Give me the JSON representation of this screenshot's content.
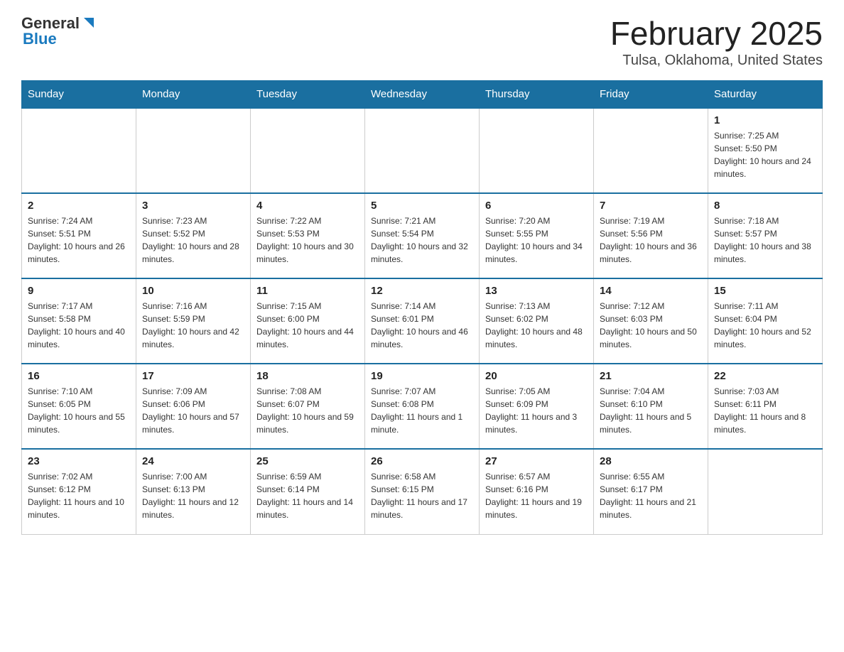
{
  "header": {
    "logo_general": "General",
    "logo_blue": "Blue",
    "month_title": "February 2025",
    "location": "Tulsa, Oklahoma, United States"
  },
  "days_of_week": [
    "Sunday",
    "Monday",
    "Tuesday",
    "Wednesday",
    "Thursday",
    "Friday",
    "Saturday"
  ],
  "weeks": [
    [
      {
        "day": "",
        "info": ""
      },
      {
        "day": "",
        "info": ""
      },
      {
        "day": "",
        "info": ""
      },
      {
        "day": "",
        "info": ""
      },
      {
        "day": "",
        "info": ""
      },
      {
        "day": "",
        "info": ""
      },
      {
        "day": "1",
        "info": "Sunrise: 7:25 AM\nSunset: 5:50 PM\nDaylight: 10 hours and 24 minutes."
      }
    ],
    [
      {
        "day": "2",
        "info": "Sunrise: 7:24 AM\nSunset: 5:51 PM\nDaylight: 10 hours and 26 minutes."
      },
      {
        "day": "3",
        "info": "Sunrise: 7:23 AM\nSunset: 5:52 PM\nDaylight: 10 hours and 28 minutes."
      },
      {
        "day": "4",
        "info": "Sunrise: 7:22 AM\nSunset: 5:53 PM\nDaylight: 10 hours and 30 minutes."
      },
      {
        "day": "5",
        "info": "Sunrise: 7:21 AM\nSunset: 5:54 PM\nDaylight: 10 hours and 32 minutes."
      },
      {
        "day": "6",
        "info": "Sunrise: 7:20 AM\nSunset: 5:55 PM\nDaylight: 10 hours and 34 minutes."
      },
      {
        "day": "7",
        "info": "Sunrise: 7:19 AM\nSunset: 5:56 PM\nDaylight: 10 hours and 36 minutes."
      },
      {
        "day": "8",
        "info": "Sunrise: 7:18 AM\nSunset: 5:57 PM\nDaylight: 10 hours and 38 minutes."
      }
    ],
    [
      {
        "day": "9",
        "info": "Sunrise: 7:17 AM\nSunset: 5:58 PM\nDaylight: 10 hours and 40 minutes."
      },
      {
        "day": "10",
        "info": "Sunrise: 7:16 AM\nSunset: 5:59 PM\nDaylight: 10 hours and 42 minutes."
      },
      {
        "day": "11",
        "info": "Sunrise: 7:15 AM\nSunset: 6:00 PM\nDaylight: 10 hours and 44 minutes."
      },
      {
        "day": "12",
        "info": "Sunrise: 7:14 AM\nSunset: 6:01 PM\nDaylight: 10 hours and 46 minutes."
      },
      {
        "day": "13",
        "info": "Sunrise: 7:13 AM\nSunset: 6:02 PM\nDaylight: 10 hours and 48 minutes."
      },
      {
        "day": "14",
        "info": "Sunrise: 7:12 AM\nSunset: 6:03 PM\nDaylight: 10 hours and 50 minutes."
      },
      {
        "day": "15",
        "info": "Sunrise: 7:11 AM\nSunset: 6:04 PM\nDaylight: 10 hours and 52 minutes."
      }
    ],
    [
      {
        "day": "16",
        "info": "Sunrise: 7:10 AM\nSunset: 6:05 PM\nDaylight: 10 hours and 55 minutes."
      },
      {
        "day": "17",
        "info": "Sunrise: 7:09 AM\nSunset: 6:06 PM\nDaylight: 10 hours and 57 minutes."
      },
      {
        "day": "18",
        "info": "Sunrise: 7:08 AM\nSunset: 6:07 PM\nDaylight: 10 hours and 59 minutes."
      },
      {
        "day": "19",
        "info": "Sunrise: 7:07 AM\nSunset: 6:08 PM\nDaylight: 11 hours and 1 minute."
      },
      {
        "day": "20",
        "info": "Sunrise: 7:05 AM\nSunset: 6:09 PM\nDaylight: 11 hours and 3 minutes."
      },
      {
        "day": "21",
        "info": "Sunrise: 7:04 AM\nSunset: 6:10 PM\nDaylight: 11 hours and 5 minutes."
      },
      {
        "day": "22",
        "info": "Sunrise: 7:03 AM\nSunset: 6:11 PM\nDaylight: 11 hours and 8 minutes."
      }
    ],
    [
      {
        "day": "23",
        "info": "Sunrise: 7:02 AM\nSunset: 6:12 PM\nDaylight: 11 hours and 10 minutes."
      },
      {
        "day": "24",
        "info": "Sunrise: 7:00 AM\nSunset: 6:13 PM\nDaylight: 11 hours and 12 minutes."
      },
      {
        "day": "25",
        "info": "Sunrise: 6:59 AM\nSunset: 6:14 PM\nDaylight: 11 hours and 14 minutes."
      },
      {
        "day": "26",
        "info": "Sunrise: 6:58 AM\nSunset: 6:15 PM\nDaylight: 11 hours and 17 minutes."
      },
      {
        "day": "27",
        "info": "Sunrise: 6:57 AM\nSunset: 6:16 PM\nDaylight: 11 hours and 19 minutes."
      },
      {
        "day": "28",
        "info": "Sunrise: 6:55 AM\nSunset: 6:17 PM\nDaylight: 11 hours and 21 minutes."
      },
      {
        "day": "",
        "info": ""
      }
    ]
  ]
}
